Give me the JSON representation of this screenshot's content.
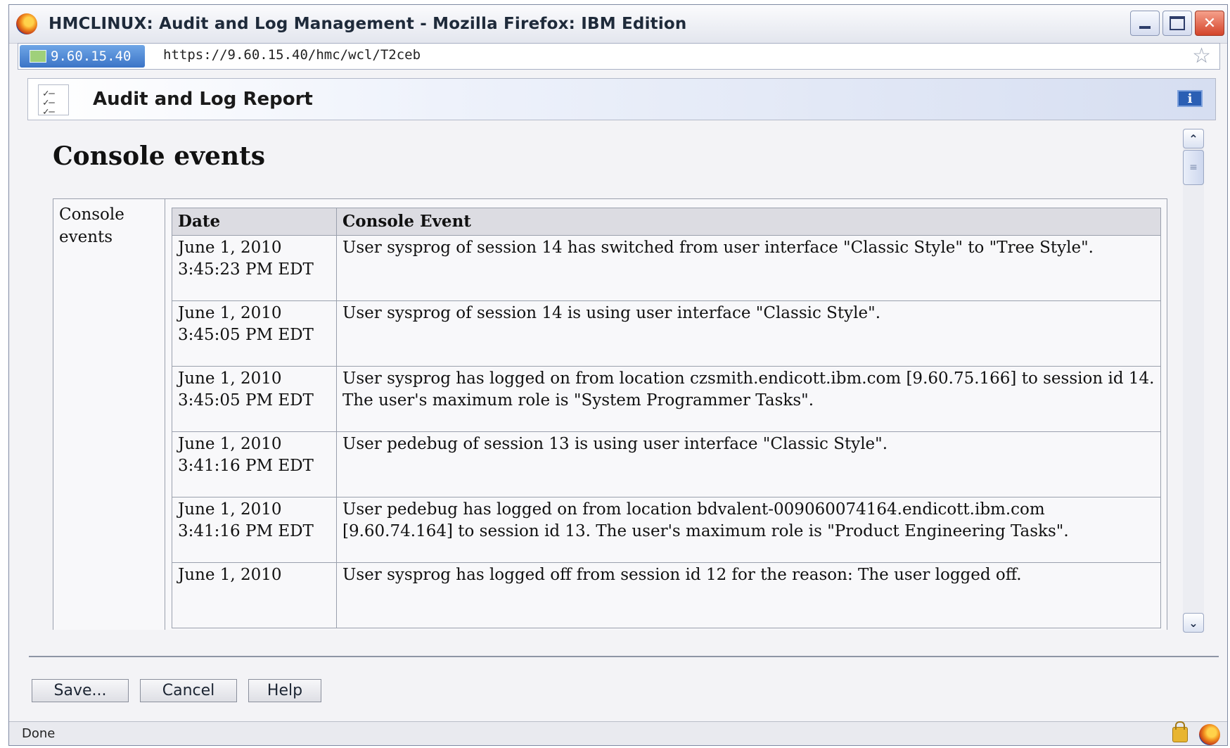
{
  "window": {
    "title": "HMCLINUX: Audit and Log Management - Mozilla Firefox: IBM Edition",
    "controls": {
      "minimize": "minimize",
      "maximize": "maximize",
      "close": "close"
    }
  },
  "urlbar": {
    "site_identity": "9.60.15.40",
    "url": "https://9.60.15.40/hmc/wcl/T2ceb"
  },
  "banner": {
    "title": "Audit and Log Report",
    "info_glyph": "i"
  },
  "report": {
    "heading": "Console events",
    "row_label": "Console events",
    "columns": {
      "date": "Date",
      "event": "Console Event"
    },
    "rows": [
      {
        "date": "June 1, 2010 3:45:23 PM EDT",
        "event": "User sysprog of session 14 has switched from user interface \"Classic Style\" to \"Tree Style\"."
      },
      {
        "date": "June 1, 2010 3:45:05 PM EDT",
        "event": "User sysprog of session 14 is using user interface \"Classic Style\"."
      },
      {
        "date": "June 1, 2010 3:45:05 PM EDT",
        "event": "User sysprog has logged on from location czsmith.endicott.ibm.com [9.60.75.166] to session id 14. The user's maximum role is \"System Programmer Tasks\"."
      },
      {
        "date": "June 1, 2010 3:41:16 PM EDT",
        "event": "User pedebug of session 13 is using user interface \"Classic Style\"."
      },
      {
        "date": "June 1, 2010 3:41:16 PM EDT",
        "event": "User pedebug has logged on from location bdvalent-009060074164.endicott.ibm.com [9.60.74.164] to session id 13. The user's maximum role is \"Product Engineering Tasks\"."
      },
      {
        "date": "June 1, 2010",
        "event": "User sysprog has logged off from session id 12 for the reason: The user logged off."
      }
    ]
  },
  "buttons": {
    "save": "Save...",
    "cancel": "Cancel",
    "help": "Help"
  },
  "status": {
    "text": "Done"
  },
  "icons": {
    "browser": "firefox-icon",
    "site": "site-identity-icon",
    "bookmark": "star-icon",
    "task": "task-checklist-icon",
    "info": "info-icon",
    "lock": "lock-icon"
  }
}
